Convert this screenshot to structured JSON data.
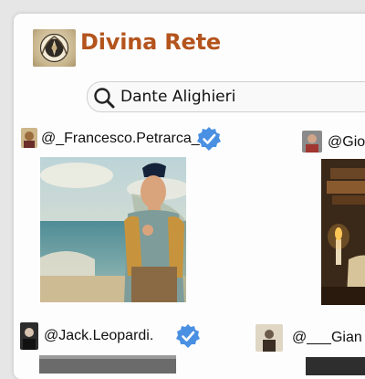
{
  "app": {
    "title": "Divina Rete",
    "logo_icon": "laurel-emblem-icon"
  },
  "search": {
    "value": "Dante Alighieri",
    "icon": "search-icon"
  },
  "posts": [
    {
      "username": "@_Francesco.Petrarca_",
      "verified": true,
      "image": "renaissance-man-by-sea"
    },
    {
      "username": "@Giov",
      "verified": false,
      "image": "candle-and-books-still-life"
    },
    {
      "username": "@Jack.Leopardi.",
      "verified": true,
      "image": ""
    },
    {
      "username": "@___Gian",
      "verified": false,
      "image": ""
    }
  ],
  "colors": {
    "brand": "#b4541d",
    "verified": "#4a90e2",
    "background": "#fdfdfd"
  }
}
